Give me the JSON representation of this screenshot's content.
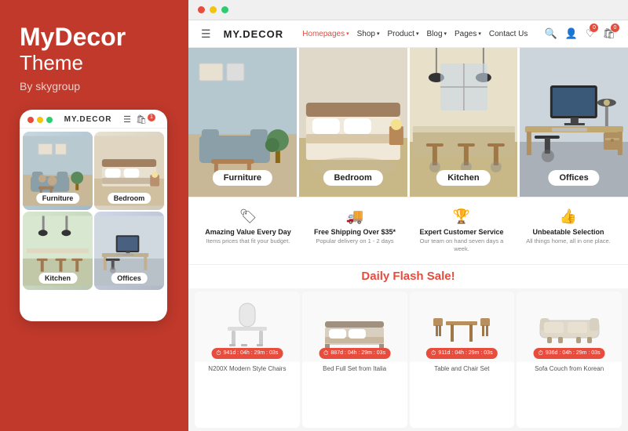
{
  "brand": {
    "title": "MyDecor",
    "subtitle": "Theme",
    "by": "By skygroup"
  },
  "nav": {
    "logo": "MY.DECOR",
    "links": [
      {
        "label": "Homepages",
        "has_dropdown": true,
        "active": true
      },
      {
        "label": "Shop",
        "has_dropdown": true
      },
      {
        "label": "Product",
        "has_dropdown": true
      },
      {
        "label": "Blog",
        "has_dropdown": true
      },
      {
        "label": "Pages",
        "has_dropdown": true
      },
      {
        "label": "Contact Us"
      }
    ],
    "cart_count": "0",
    "wish_count": "0"
  },
  "hero_categories": [
    {
      "label": "Furniture"
    },
    {
      "label": "Bedroom"
    },
    {
      "label": "Kitchen"
    },
    {
      "label": "Offices"
    }
  ],
  "mobile_categories": [
    {
      "label": "Furniture"
    },
    {
      "label": "Bedroom"
    },
    {
      "label": "Kitchen"
    },
    {
      "label": "Offices"
    }
  ],
  "features": [
    {
      "icon": "🏷",
      "title": "Amazing Value Every Day",
      "desc": "Items prices that fit your budget."
    },
    {
      "icon": "🚚",
      "title": "Free Shipping Over $35*",
      "desc": "Popular delivery on 1 - 2 days"
    },
    {
      "icon": "🏆",
      "title": "Expert Customer Service",
      "desc": "Our team on hand seven days a week."
    },
    {
      "icon": "👍",
      "title": "Unbeatable Selection",
      "desc": "All things home, all in one place."
    }
  ],
  "flash_sale": {
    "title": "Daily Flash Sale!"
  },
  "products": [
    {
      "name": "N200X Modern Style Chairs",
      "timer": "941d : 04h : 29m : 03s"
    },
    {
      "name": "Bed Full Set from Italia",
      "timer": "887d : 04h : 29m : 03s"
    },
    {
      "name": "Table and Chair Set",
      "timer": "911d : 04h : 29m : 03s"
    },
    {
      "name": "Sofa Couch from Korean",
      "timer": "936d : 04h : 29m : 03s"
    }
  ]
}
